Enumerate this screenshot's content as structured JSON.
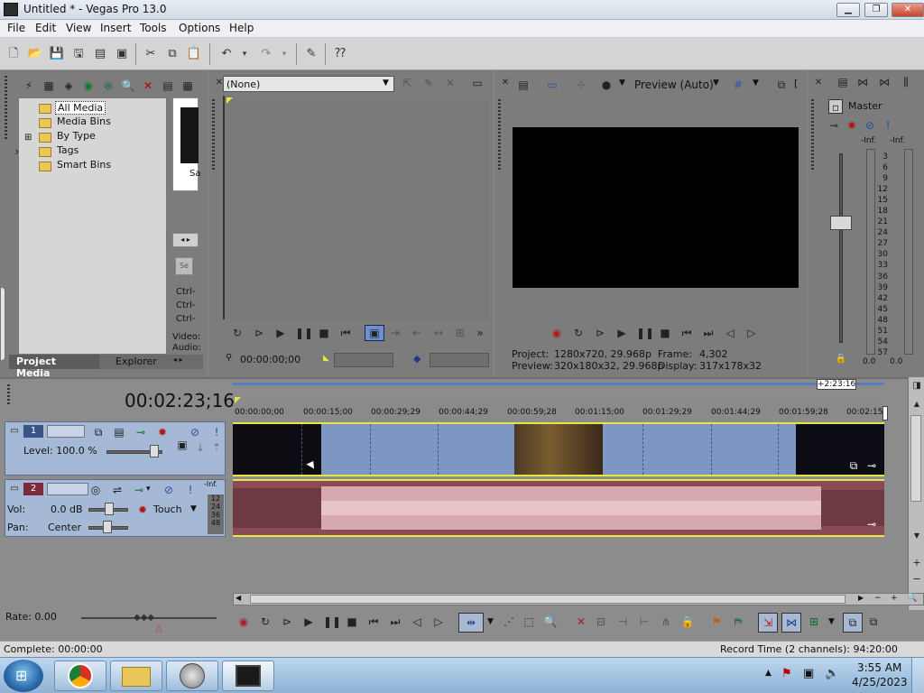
{
  "window": {
    "title": "Untitled * - Vegas Pro 13.0"
  },
  "menu": [
    "File",
    "Edit",
    "View",
    "Insert",
    "Tools",
    "Options",
    "Help"
  ],
  "media_tree": {
    "items": [
      "All Media",
      "Media Bins",
      "By Type",
      "Tags",
      "Smart Bins"
    ]
  },
  "media_panel": {
    "thumb_label": "Sa",
    "ctrl_lines": [
      "Ctrl-",
      "Ctrl-",
      "Ctrl-"
    ],
    "video_label": "Video:",
    "audio_label": "Audio:"
  },
  "tabs": {
    "project_media": "Project Media",
    "explorer": "Explorer"
  },
  "trimmer": {
    "select_value": "(None)",
    "timecode": "00:00:00;00"
  },
  "preview": {
    "mode": "Preview (Auto)",
    "project_label": "Project:",
    "project_value": "1280x720, 29.968p",
    "preview_label": "Preview:",
    "preview_value": "320x180x32, 29.968p",
    "frame_label": "Frame:",
    "frame_value": "4,302",
    "display_label": "Display:",
    "display_value": "317x178x32"
  },
  "mixer": {
    "master": "Master",
    "inf_left": "-Inf.",
    "inf_right": "-Inf.",
    "db_scale": [
      "3",
      "6",
      "9",
      "12",
      "15",
      "18",
      "21",
      "24",
      "27",
      "30",
      "33",
      "36",
      "39",
      "42",
      "45",
      "48",
      "51",
      "54",
      "57"
    ],
    "bottom_left": "0.0",
    "bottom_right": "0.0"
  },
  "timeline": {
    "cursor_time": "00:02:23;16",
    "marker_time": "+2:23:16",
    "ruler": [
      "00:00:00;00",
      "00:00:15;00",
      "00:00:29;29",
      "00:00:44;29",
      "00:00:59;28",
      "00:01:15;00",
      "00:01:29;29",
      "00:01:44;29",
      "00:01:59;28",
      "00:02:15"
    ],
    "track1": {
      "number": "1",
      "level_label": "Level: 100.0 %"
    },
    "track2": {
      "number": "2",
      "vol_label": "Vol:",
      "vol_value": "0.0 dB",
      "pan_label": "Pan:",
      "pan_value": "Center",
      "mode": "Touch",
      "inf": "-Inf.",
      "meter_scale": [
        "12",
        "24",
        "36",
        "48"
      ]
    }
  },
  "rate": "Rate: 0.00",
  "status": {
    "left": "Complete: 00:00:00",
    "right": "Record Time (2 channels): 94:20:00"
  },
  "taskbar": {
    "time": "3:55 AM",
    "date": "4/25/2023"
  }
}
